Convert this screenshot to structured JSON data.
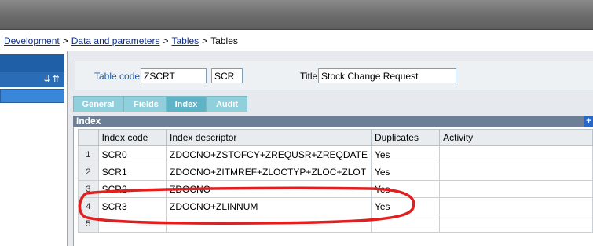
{
  "breadcrumb": {
    "items": [
      "Development",
      "Data and parameters",
      "Tables",
      "Tables"
    ],
    "separator": ">"
  },
  "header": {
    "table_code_label": "Table code",
    "table_code_value": "ZSCRT",
    "abbrev_value": "SCR",
    "title_label": "Title",
    "title_value": "Stock Change Request"
  },
  "tabs": [
    {
      "label": "General"
    },
    {
      "label": "Fields"
    },
    {
      "label": "Index"
    },
    {
      "label": "Audit"
    }
  ],
  "active_tab": "Index",
  "section": {
    "title": "Index",
    "plus": "+"
  },
  "grid": {
    "columns": [
      "Index code",
      "Index descriptor",
      "Duplicates",
      "Activity"
    ],
    "rows": [
      {
        "num": "1",
        "code": "SCR0",
        "descriptor": "ZDOCNO+ZSTOFCY+ZREQUSR+ZREQDATE",
        "duplicates": "Yes",
        "activity": ""
      },
      {
        "num": "2",
        "code": "SCR1",
        "descriptor": "ZDOCNO+ZITMREF+ZLOCTYP+ZLOC+ZLOT",
        "duplicates": "Yes",
        "activity": ""
      },
      {
        "num": "3",
        "code": "SCR2",
        "descriptor": "ZDOCNO",
        "duplicates": "Yes",
        "activity": ""
      },
      {
        "num": "4",
        "code": "SCR3",
        "descriptor": "ZDOCNO+ZLINNUM",
        "duplicates": "Yes",
        "activity": ""
      },
      {
        "num": "5",
        "code": "",
        "descriptor": "",
        "duplicates": "",
        "activity": ""
      }
    ]
  },
  "colors": {
    "annotation_red": "#e02020",
    "tab_active": "#5fb3c6",
    "tab_inactive": "#8fd0dc",
    "link": "#0b2e8a"
  }
}
